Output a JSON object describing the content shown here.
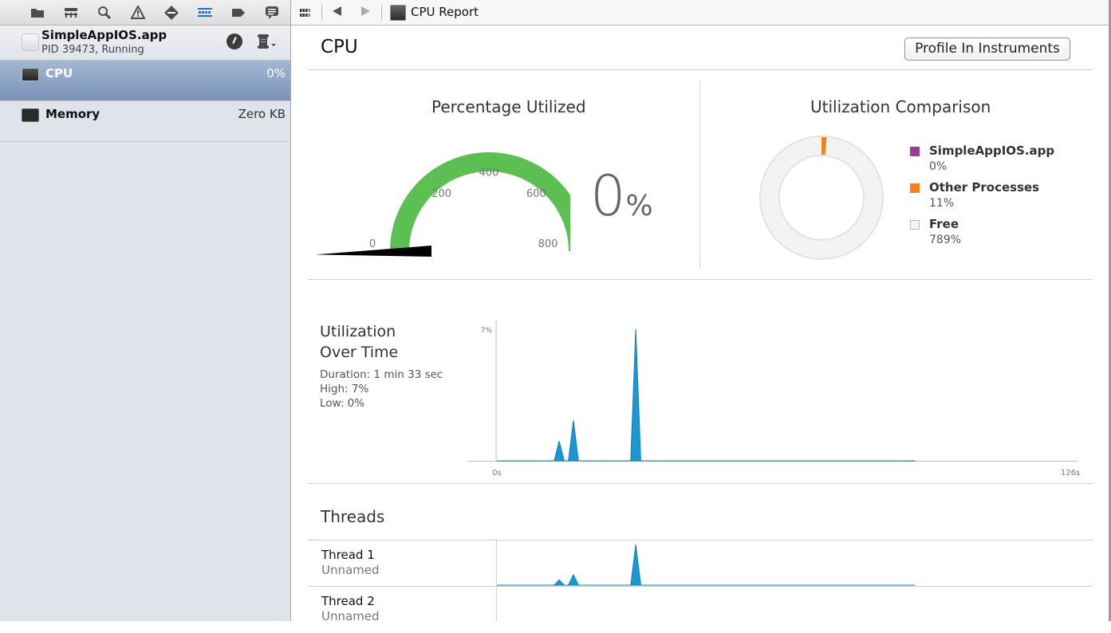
{
  "navigator": {
    "icons": [
      "folder-icon",
      "hierarchy-icon",
      "search-icon",
      "warning-icon",
      "breakpoint-icon",
      "debug-navigator-icon",
      "tag-icon",
      "log-icon"
    ],
    "active_index": 5
  },
  "process": {
    "name": "SimpleAppIOS.app",
    "status": "PID 39473, Running"
  },
  "gauges": [
    {
      "label": "CPU",
      "value": "0%",
      "selected": true
    },
    {
      "label": "Memory",
      "value": "Zero KB",
      "selected": false
    }
  ],
  "jump_bar": {
    "title": "CPU Report"
  },
  "page": {
    "title": "CPU",
    "profile_button": "Profile In Instruments"
  },
  "percentage_utilized": {
    "title": "Percentage Utilized",
    "value": "0",
    "unit": "%",
    "gauge_ticks": [
      "0",
      "200",
      "400",
      "600",
      "800"
    ],
    "gauge_max": 800,
    "gauge_value": 0,
    "arc_color": "#5cbf52"
  },
  "utilization_comparison": {
    "title": "Utilization Comparison",
    "legend": [
      {
        "name": "SimpleAppIOS.app",
        "value": "0%",
        "color": "#9a3d9a"
      },
      {
        "name": "Other Processes",
        "value": "11%",
        "color": "#f2821e"
      },
      {
        "name": "Free",
        "value": "789%",
        "color": "#f3f3f3"
      }
    ]
  },
  "utilization_over_time": {
    "title_line1": "Utilization",
    "title_line2": "Over Time",
    "duration": "Duration: 1 min 33 sec",
    "high": "High: 7%",
    "low": "Low: 0%"
  },
  "threads": {
    "title": "Threads",
    "rows": [
      {
        "name": "Thread 1",
        "sub": "Unnamed"
      },
      {
        "name": "Thread 2",
        "sub": "Unnamed"
      }
    ]
  },
  "chart_data": [
    {
      "type": "pie",
      "title": "Utilization Comparison",
      "labels": [
        "SimpleAppIOS.app",
        "Other Processes",
        "Free"
      ],
      "values": [
        0,
        11,
        789
      ],
      "colors": [
        "#9a3d9a",
        "#f2821e",
        "#f3f3f3"
      ],
      "donut": true
    },
    {
      "type": "area",
      "title": "Utilization Over Time",
      "x_unit": "s",
      "xlim": [
        0,
        126
      ],
      "ylim": [
        0,
        7
      ],
      "x_tick_labels": [
        "0s",
        "126s"
      ],
      "y_tick_labels": [
        "7%"
      ],
      "color": "#1a98d5",
      "x": [
        0,
        12.5,
        13.6,
        14.7,
        15.6,
        16.7,
        17.8,
        29.2,
        30.3,
        31.4,
        91.3
      ],
      "y": [
        0,
        0,
        1.05,
        0,
        0,
        2.15,
        0,
        0,
        7,
        0,
        0
      ]
    },
    {
      "type": "area",
      "title": "Thread 1",
      "xlim": [
        0,
        126
      ],
      "ylim": [
        0,
        7
      ],
      "color": "#1a98d5",
      "x": [
        0,
        12.5,
        13.6,
        14.7,
        15.6,
        16.7,
        17.8,
        29.2,
        30.3,
        31.4,
        91.3
      ],
      "y": [
        0,
        0,
        0.9,
        0,
        0,
        1.8,
        0,
        0,
        7,
        0,
        0
      ]
    }
  ]
}
